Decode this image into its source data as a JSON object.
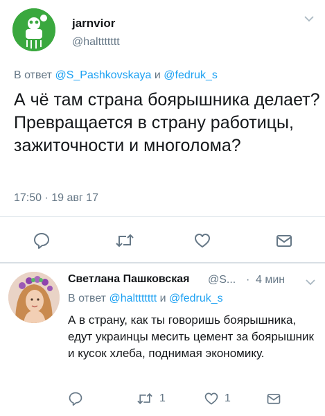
{
  "main_tweet": {
    "author_name": "jarnvior",
    "author_handle": "@halttttttt",
    "reply_prefix": "В ответ ",
    "reply_user_1": "@S_Pashkovskaya",
    "reply_and": " и ",
    "reply_user_2": "@fedruk_s",
    "text": "А чё там страна боярышника делает? Превращается в страну работицы, зажиточности и многолома?",
    "timestamp": "17:50 · 19 авг 17"
  },
  "reply_tweet": {
    "author_name": "Светлана Пашковская",
    "author_handle": "@S...",
    "separator": "·",
    "time": "4 мин",
    "reply_prefix": "В ответ ",
    "reply_user_1": "@halttttttt",
    "reply_and": " и ",
    "reply_user_2": "@fedruk_s",
    "text": "А в страну, как ты говоришь боярышника, едут украинцы месить цемент за боярышник и кусок хлеба, поднимая экономику.",
    "retweet_count": "1",
    "like_count": "1"
  },
  "icons": [
    "caret-down-icon",
    "reply-icon",
    "retweet-icon",
    "like-icon",
    "message-icon"
  ],
  "colors": {
    "link": "#1da1f2",
    "secondary_text": "#657786",
    "icon_gray": "#657786",
    "divider": "#e1e8ed",
    "avatar_green": "#3aa83e"
  }
}
